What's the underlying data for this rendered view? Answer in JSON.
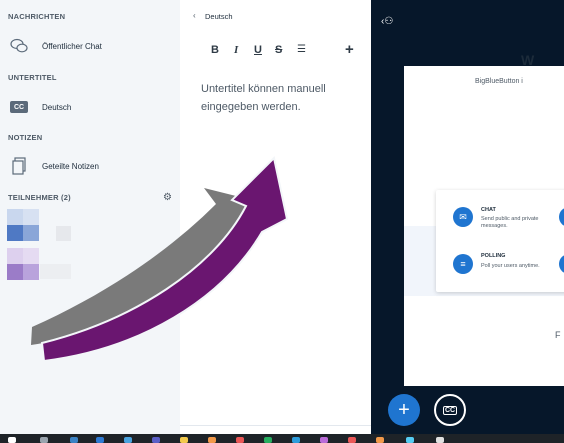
{
  "sidebar": {
    "messages_title": "NACHRICHTEN",
    "public_chat": "Öffentlicher Chat",
    "captions_title": "UNTERTITEL",
    "caption_cc": "CC",
    "caption_language": "Deutsch",
    "notes_title": "NOTIZEN",
    "shared_notes": "Geteilte Notizen",
    "users_title": "TEILNEHMER (2)"
  },
  "captions_panel": {
    "back_label": "Deutsch",
    "toolbar": {
      "bold": "B",
      "italic": "I",
      "underline": "U",
      "strike": "S",
      "list": "☰",
      "add": "+"
    },
    "editor_text": "Untertitel können manuell eingegeben werden."
  },
  "presentation": {
    "title_partial": "W",
    "subtitle_partial": "BigBlueButton i",
    "features": [
      {
        "title": "CHAT",
        "desc": "Send public and private messages."
      },
      {
        "title": "POLLING",
        "desc": "Poll your users anytime."
      }
    ],
    "footer_partial": "F",
    "fab_plus": "+",
    "fab_cc": "CC"
  },
  "icons": [
    "chat-bubbles-icon",
    "cc-icon",
    "notes-icon",
    "gear-icon",
    "back-chevron-icon",
    "user-list-toggle-icon",
    "plus-icon"
  ],
  "colors": {
    "accent": "#1f75d0",
    "sidebar_bg": "#f3f6f9",
    "main_bg": "#06172a",
    "arrow_purple": "#6a1670",
    "arrow_gray": "#7a7a7a"
  }
}
